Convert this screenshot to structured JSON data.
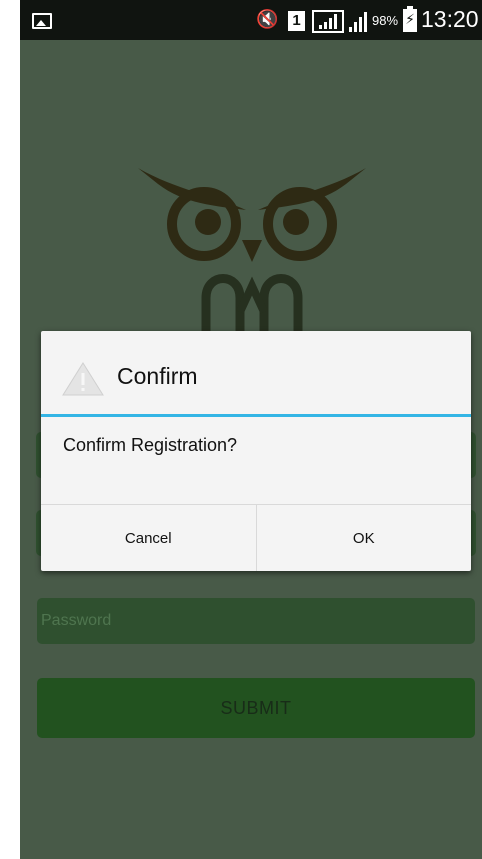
{
  "status_bar": {
    "icons": [
      "gallery-icon",
      "mute-icon",
      "sim-icon",
      "signal-icon",
      "signal-icon",
      "battery-charging-icon"
    ],
    "sim_label": "1",
    "battery": "98%",
    "time": "13:20"
  },
  "form": {
    "password_placeholder": "Password",
    "submit_label": "SUBMIT"
  },
  "dialog": {
    "title": "Confirm",
    "message": "Confirm Registration?",
    "cancel_label": "Cancel",
    "ok_label": "OK"
  },
  "colors": {
    "background": "#485a48",
    "field": "#2f502f",
    "submit": "#22521f",
    "logo": "#2e2a14",
    "dialog_accent": "#33b5e5"
  }
}
